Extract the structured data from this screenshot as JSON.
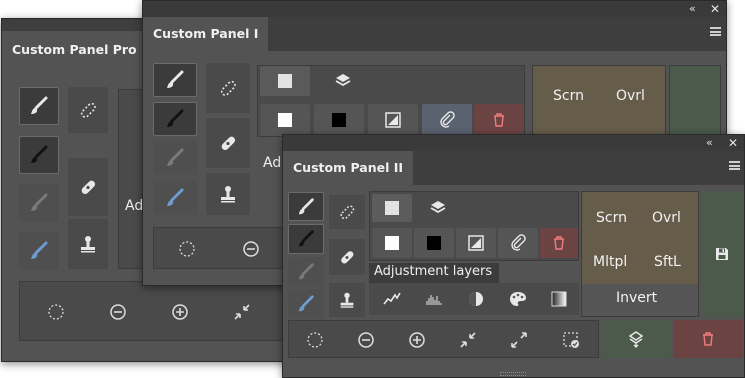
{
  "panels": {
    "pro": {
      "title": "Custom Panel Pro",
      "adj_label": "Adj"
    },
    "one": {
      "title": "Custom Panel I",
      "blend": [
        "Scrn",
        "Ovrl"
      ],
      "adj_label": "Ad"
    },
    "two": {
      "title": "Custom Panel II",
      "blend": {
        "screen": "Scrn",
        "overlay": "Ovrl",
        "multiply": "Mltpl",
        "softlight": "SftL",
        "invert": "Invert"
      },
      "adjustment_title": "Adjustment layers",
      "adjustment_icons": [
        "curves-icon",
        "levels-icon",
        "hue-saturation-icon",
        "color-palette-icon",
        "gradient-map-icon"
      ],
      "selection_icons": [
        "ellipse-select-icon",
        "subtract-select-icon",
        "add-select-icon",
        "shrink-icon",
        "expand-icon",
        "select-subject-icon"
      ]
    }
  },
  "controls": {
    "collapse": "«",
    "close": "✕"
  },
  "colors": {
    "panel_bg": "#535353",
    "tab_bar": "#3e3e3e",
    "blend_bg": "#665c4a",
    "merge_bg": "#4c5a4b",
    "delete_bg": "#6b4343",
    "delete_icon": "#f07d7d",
    "brush_blue": "#6e9bd2"
  }
}
